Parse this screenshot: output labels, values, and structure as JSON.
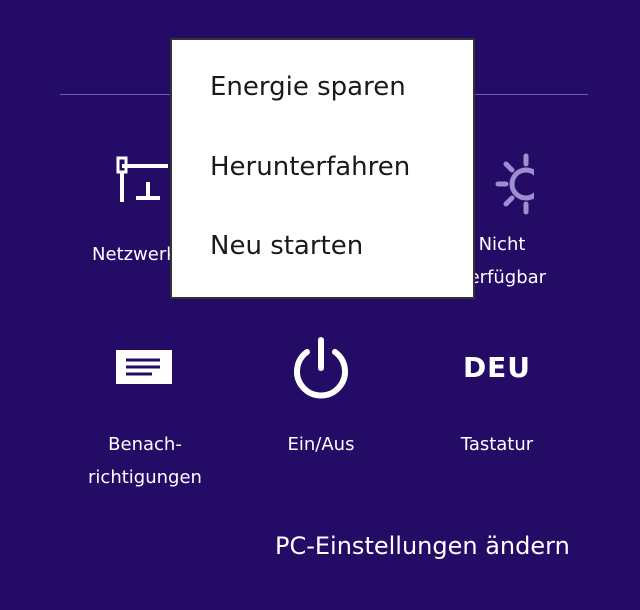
{
  "settings": {
    "network_label": "Netzwerk",
    "brightness_label": "Nicht\nverfügbar",
    "notifications_label": "Benach-\nrichtigungen",
    "power_label": "Ein/Aus",
    "keyboard_glyph": "DEU",
    "keyboard_label": "Tastatur",
    "pc_settings_link": "PC-Einstellungen ändern"
  },
  "power_menu": {
    "items": [
      {
        "label": "Energie sparen"
      },
      {
        "label": "Herunterfahren"
      },
      {
        "label": "Neu starten"
      }
    ]
  },
  "colors": {
    "background": "#230b66",
    "divider": "#6a5bb3",
    "text": "#ffffff",
    "menu_background": "#ffffff",
    "menu_text": "#1a1a1a",
    "disabled_icon": "#9b8fd1"
  },
  "icons": [
    "network-icon",
    "brightness-icon",
    "notifications-icon",
    "power-icon",
    "keyboard-icon"
  ]
}
